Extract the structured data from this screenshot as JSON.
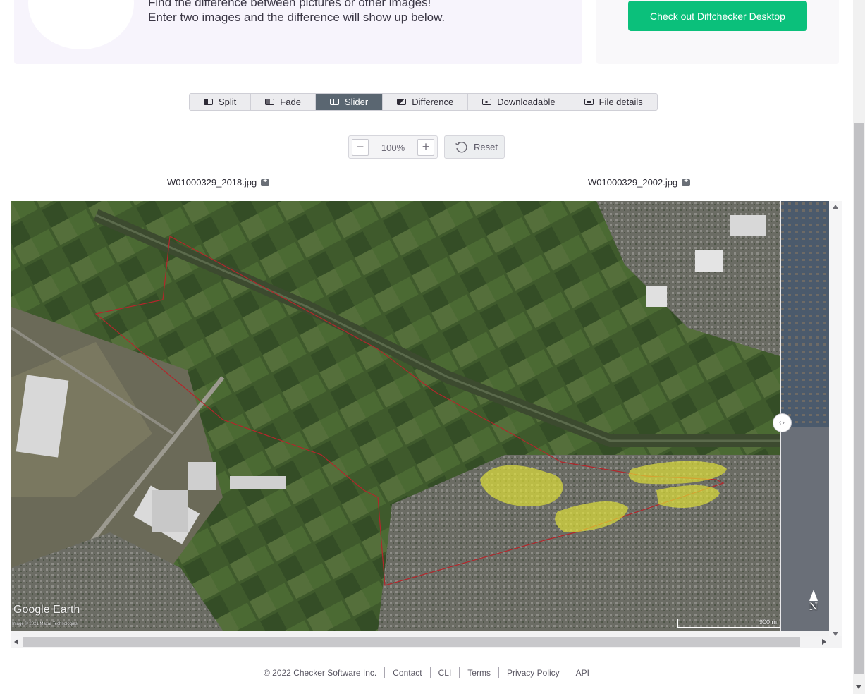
{
  "hero": {
    "line1": "Find the difference between pictures or other images!",
    "line2": "Enter two images and the difference will show up below."
  },
  "promo": {
    "button_label": "Check out Diffchecker Desktop"
  },
  "tabs": [
    {
      "label": "Split",
      "icon": "split-view-icon"
    },
    {
      "label": "Fade",
      "icon": "fade-view-icon"
    },
    {
      "label": "Slider",
      "icon": "slider-view-icon",
      "active": true
    },
    {
      "label": "Difference",
      "icon": "difference-view-icon"
    },
    {
      "label": "Downloadable",
      "icon": "downloadable-icon"
    },
    {
      "label": "File details",
      "icon": "file-details-icon"
    }
  ],
  "zoom": {
    "value": "100%",
    "minus": "−",
    "plus": "+",
    "reset_label": "Reset"
  },
  "files": {
    "left_name": "W01000329_2018.jpg",
    "right_name": "W01000329_2002.jpg"
  },
  "viewer": {
    "slider_handle": "‹›",
    "watermark": "Google Earth",
    "credit": "Image © 2021 Maxar Technologies",
    "scale_label": "900 m",
    "north_label": "N"
  },
  "footer": {
    "copyright": "© 2022 Checker Software Inc.",
    "links": [
      "Contact",
      "CLI",
      "Terms",
      "Privacy Policy",
      "API"
    ]
  },
  "colors": {
    "accent_green": "#0bc07b",
    "active_tab": "#5a6671",
    "boundary_red": "#b3262b",
    "highlight_yellow": "#e6e835"
  }
}
